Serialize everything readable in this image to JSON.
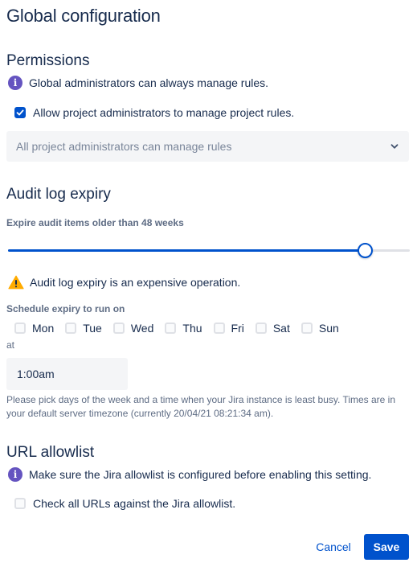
{
  "page": {
    "title": "Global configuration"
  },
  "permissions": {
    "heading": "Permissions",
    "info_text": "Global administrators can always manage rules.",
    "checkbox_label": "Allow project administrators to manage project rules.",
    "checkbox_checked": true,
    "select_value": "All project administrators can manage rules"
  },
  "audit": {
    "heading": "Audit log expiry",
    "expire_label": "Expire audit items older than 48 weeks",
    "slider_fraction": 0.888,
    "warning_text": "Audit log expiry is an expensive operation.",
    "schedule_label": "Schedule expiry to run on",
    "days": [
      {
        "label": "Mon",
        "checked": false
      },
      {
        "label": "Tue",
        "checked": false
      },
      {
        "label": "Wed",
        "checked": false
      },
      {
        "label": "Thu",
        "checked": false
      },
      {
        "label": "Fri",
        "checked": false
      },
      {
        "label": "Sat",
        "checked": false
      },
      {
        "label": "Sun",
        "checked": false
      }
    ],
    "at_label": "at",
    "time_value": "1:00am",
    "help_text": "Please pick days of the week and a time when your Jira instance is least busy. Times are in your default server timezone (currently 20/04/21 08:21:34 am)."
  },
  "url_allowlist": {
    "heading": "URL allowlist",
    "info_text": "Make sure the Jira allowlist is configured before enabling this setting.",
    "checkbox_label": "Check all URLs against the Jira allowlist.",
    "checkbox_checked": false
  },
  "footer": {
    "cancel_label": "Cancel",
    "save_label": "Save"
  },
  "colors": {
    "primary": "#0052cc",
    "info": "#6554c0",
    "warning": "#ffab00",
    "text": "#172b4d",
    "subtle": "#5e6c84"
  },
  "icons": {
    "info": "info-icon",
    "warning": "warning-icon",
    "check": "check-icon",
    "chevron": "chevron-down-icon"
  }
}
